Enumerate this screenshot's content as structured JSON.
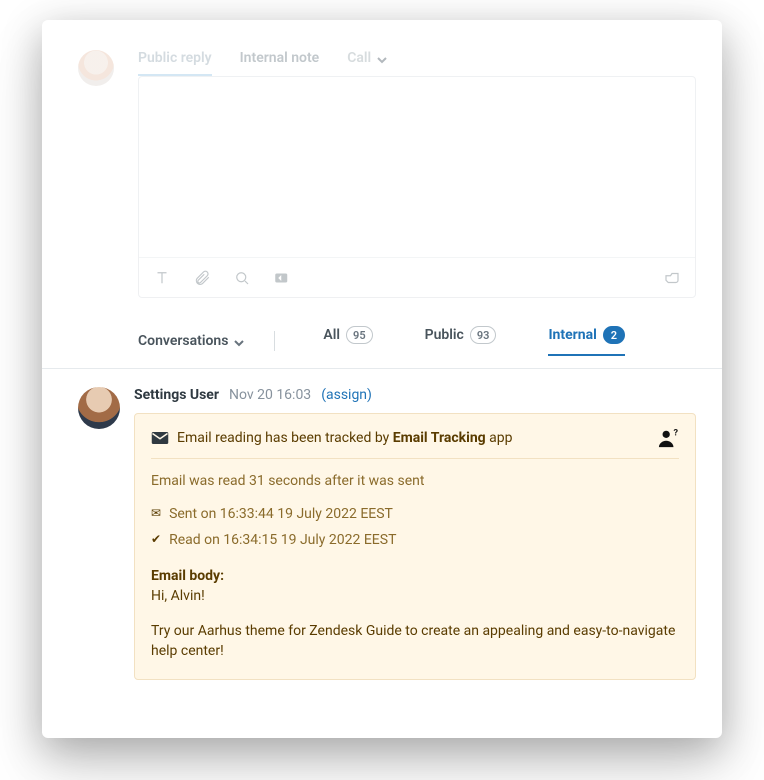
{
  "compose": {
    "tabs": {
      "public": "Public reply",
      "internal": "Internal note",
      "call": "Call"
    }
  },
  "filters": {
    "label": "Conversations",
    "all": {
      "label": "All",
      "count": "95"
    },
    "public": {
      "label": "Public",
      "count": "93"
    },
    "internal": {
      "label": "Internal",
      "count": "2"
    }
  },
  "event": {
    "author": "Settings User",
    "timestamp": "Nov 20 16:03",
    "assign": "(assign)"
  },
  "note": {
    "tracked_prefix": "Email reading has been tracked by ",
    "app_name": "Email Tracking",
    "app_suffix": " app",
    "read_delay": "Email was read 31 seconds after it was sent",
    "sent_line": "Sent on 16:33:44 19 July 2022 EEST",
    "read_line": "Read on 16:34:15 19 July 2022 EEST",
    "body_label": "Email body:",
    "body_line1": "Hi, Alvin!",
    "body_line2": "Try our Aarhus theme for Zendesk Guide to create an appealing and easy-to-navigate help center!"
  }
}
